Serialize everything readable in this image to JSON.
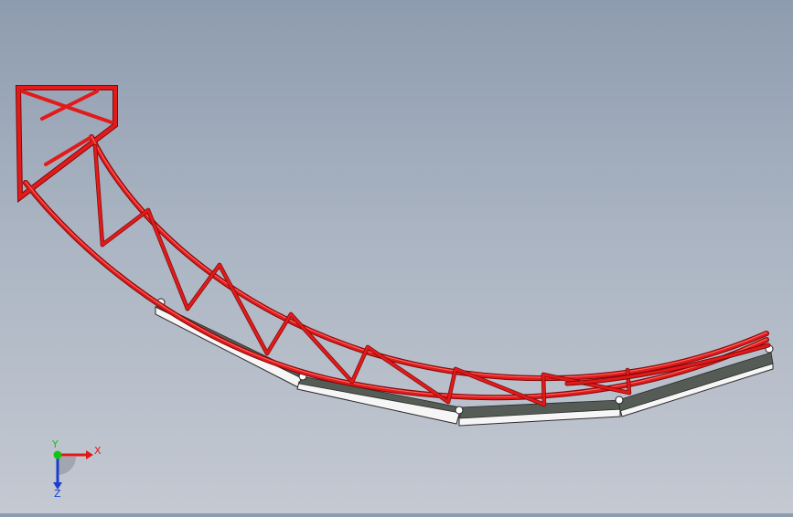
{
  "viewport": {
    "background_top": "#8e9caf",
    "background_bottom": "#c4c9d2"
  },
  "truss": {
    "color": "#e01818",
    "edge_color": "#8a0c0c"
  },
  "shoes": {
    "top_face_color": "#555c55",
    "bottom_face_color": "#ffffff",
    "outline_color": "#2a2a2a",
    "count": 4
  },
  "triad": {
    "x_label": "X",
    "y_label": "Y",
    "z_label": "Z",
    "x_color": "#e01818",
    "y_color": "#16c216",
    "z_color": "#1a3fd0"
  }
}
